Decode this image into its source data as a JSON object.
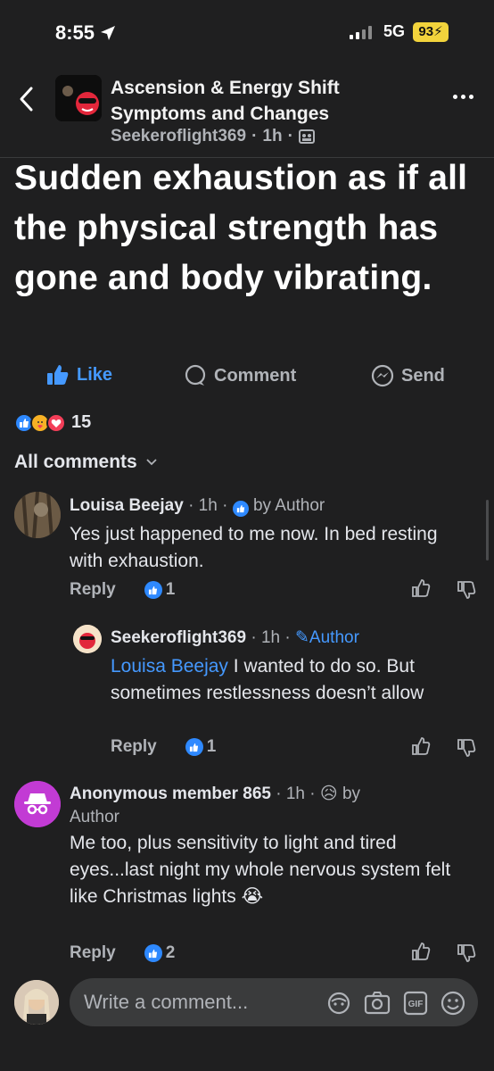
{
  "status_bar": {
    "time": "8:55",
    "network": "5G",
    "battery": "93"
  },
  "header": {
    "group_title": "Ascension & Energy Shift Symptoms and Changes",
    "author": "Seekeroflight369",
    "sep": "·",
    "time_ago": "1h"
  },
  "post": {
    "text": "Sudden exhaustion as if all the physical strength has gone and body vibrating.",
    "like_label": "Like",
    "comment_label": "Comment",
    "send_label": "Send",
    "reaction_count": "15"
  },
  "all_comments_label": "All comments",
  "comments": [
    {
      "name": "Louisa Beejay",
      "time": "1h",
      "badge": "by Author",
      "text": "Yes just happened to me now. In bed resting with exhaustion.",
      "reply": "Reply",
      "likes": "1"
    },
    {
      "name": "Seekeroflight369",
      "time": "1h",
      "badge": "Author",
      "mention": "Louisa Beejay",
      "text": " I wanted to do so. But sometimes restlessness doesn’t allow",
      "reply": "Reply",
      "likes": "1"
    },
    {
      "name": "Anonymous member 865",
      "time": "1h",
      "badge_by": "by",
      "badge_author": "Author",
      "text": "Me too, plus sensitivity to light and tired eyes...last night my whole nervous system felt like Christmas lights",
      "emoji": "😭",
      "reply": "Reply",
      "likes": "2"
    }
  ],
  "composer": {
    "placeholder": "Write a comment..."
  },
  "colors": {
    "accent": "#4599ff",
    "background": "#1f1f20",
    "input": "#3a3b3c"
  }
}
